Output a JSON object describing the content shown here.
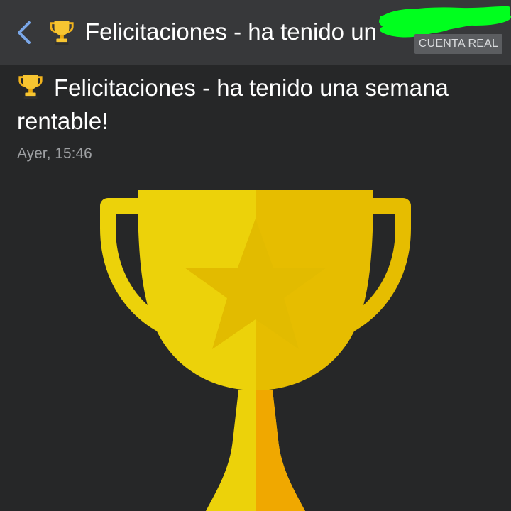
{
  "header": {
    "back_icon": "chevron-left-icon",
    "trophy_icon": "trophy-icon",
    "title": "Felicitaciones - ha tenido un",
    "account_badge": "CUENTA REAL",
    "colors": {
      "bar": "#37383a",
      "back": "#7aa7e8",
      "badge": "#5b5d60",
      "scribble": "#00ff1e"
    }
  },
  "message": {
    "trophy_icon": "trophy-icon",
    "title": "Felicitaciones - ha tenido una semana rentable!",
    "timestamp": "Ayer, 15:46"
  },
  "illustration": {
    "icon": "trophy-star-icon",
    "colors": {
      "light": "#ecd20a",
      "dark": "#e6bd00",
      "star": "#e2bb00",
      "stem": "#f0a800"
    }
  }
}
